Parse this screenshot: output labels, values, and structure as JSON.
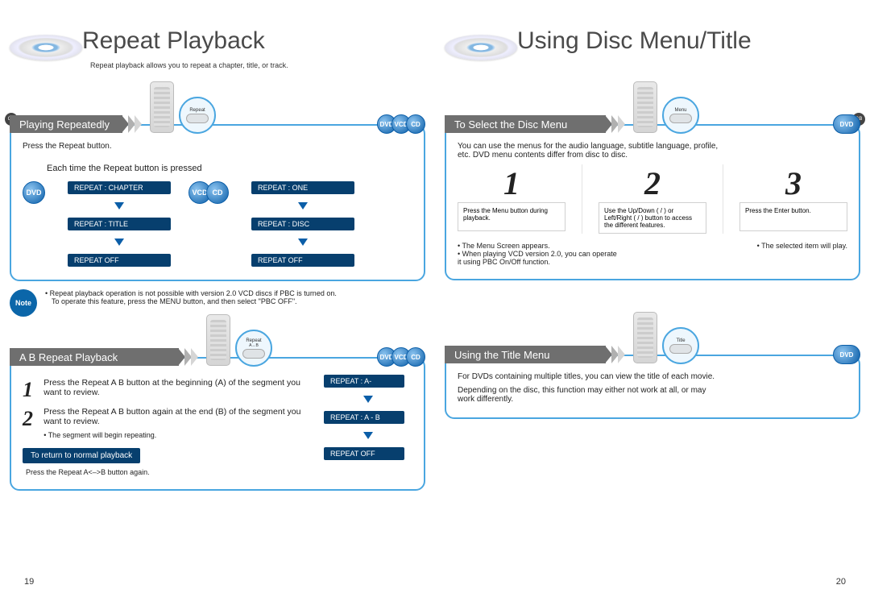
{
  "left": {
    "title": "Repeat Playback",
    "subtitle": "Repeat playback allows you to repeat a chapter, title, or track.",
    "pageNo": "19",
    "gb": "GB",
    "sec1": {
      "ribbon": "Playing Repeatedly",
      "zoom": "Repeat",
      "pills": [
        "DVD",
        "VCD",
        "CD"
      ],
      "press": "Press the Repeat button.",
      "eachTime": "Each time the Repeat button is pressed",
      "dvd": "DVD",
      "vcdcd": [
        "VCD",
        "CD"
      ],
      "flowA": [
        "REPEAT : CHAPTER",
        "REPEAT : TITLE",
        "REPEAT OFF"
      ],
      "flowB": [
        "REPEAT : ONE",
        "REPEAT : DISC",
        "REPEAT OFF"
      ]
    },
    "note": {
      "label": "Note",
      "l1": "Repeat playback operation is not possible with version 2.0 VCD discs if PBC is turned on.",
      "l2": "To operate this feature, press the MENU button, and then select \"PBC OFF\"."
    },
    "sec2": {
      "ribbon": "A    B Repeat Playback",
      "zoom": "Repeat",
      "zoom2": "A↔B",
      "pills": [
        "DVD",
        "VCD",
        "CD"
      ],
      "s1": "Press the  Repeat A    B button at the beginning (A) of the segment you want to review.",
      "s2": "Press the Repeat A    B button again at the end (B) of the segment you want to review.",
      "s2b": "The segment will begin repeating.",
      "returnLabel": "To return to normal playback",
      "returnText": "Press the Repeat A<–>B button again.",
      "flow": [
        "REPEAT : A-",
        "REPEAT : A - B",
        "REPEAT OFF"
      ]
    }
  },
  "right": {
    "title": "Using Disc Menu/Title",
    "pageNo": "20",
    "gb": "GB",
    "sec1": {
      "ribbon": "To Select the Disc Menu",
      "zoom": "Menu",
      "pill": "DVD",
      "intro": "You can use the menus for the audio language, subtitle language, profile, etc. DVD menu contents differ from disc to disc.",
      "steps": {
        "n1": "1",
        "n2": "2",
        "n3": "3",
        "b1": "Press the Menu button during playback.",
        "b2": "Use the Up/Down (      /      ) or Left/Right (      /      ) button to access the different features.",
        "b3": "Press the Enter  button."
      },
      "bl1": "The Menu Screen appears.",
      "bl2": "When playing VCD version 2.0, you can operate it using PBC On/Off function.",
      "br1": "The selected item will play."
    },
    "sec2": {
      "ribbon": "Using the Title Menu",
      "zoom": "Title",
      "pill": "DVD",
      "p1": "For DVDs containing multiple titles, you can view the title of each movie.",
      "p2": "Depending on the disc, this function may either not work at all, or may work differently."
    }
  }
}
